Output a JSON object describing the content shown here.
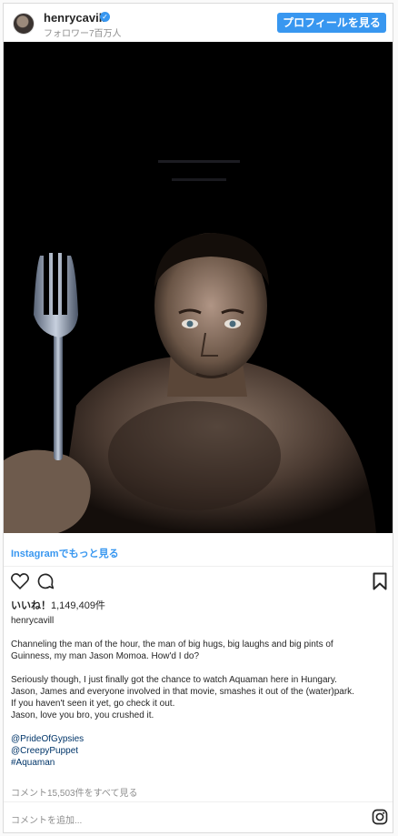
{
  "header": {
    "username": "henrycavill",
    "followers": "フォロワー7百万人",
    "profile_button": "プロフィールを見る"
  },
  "post": {
    "more_link": "Instagramでもっと見る",
    "likes_label": "いいね！",
    "likes_count": "1,149,409件",
    "owner": "henrycavill",
    "caption": [
      "Channeling the man of the hour, the man of big hugs, big laughs and big pints of",
      "Guinness, my man Jason Momoa. How'd I do?",
      "",
      "Seriously though, I just finally got the chance to watch Aquaman here in Hungary.",
      "Jason, James and everyone involved in that movie, smashes it out of the (water)park.",
      "If you haven't seen it yet, go check it out.",
      "Jason, love you bro, you crushed it.",
      ""
    ],
    "tags": [
      "@PrideOfGypsies",
      "@CreepyPuppet",
      "#Aquaman"
    ],
    "comments_link": "コメント15,503件をすべて見る",
    "comment_placeholder": "コメントを追加..."
  },
  "icons": {
    "heart": "heart-icon",
    "comment": "comment-bubble-icon",
    "bookmark": "bookmark-icon",
    "instagram": "instagram-logo-icon"
  },
  "colors": {
    "accent": "#3897f0",
    "muted": "#8e8e8e",
    "link": "#003569"
  }
}
